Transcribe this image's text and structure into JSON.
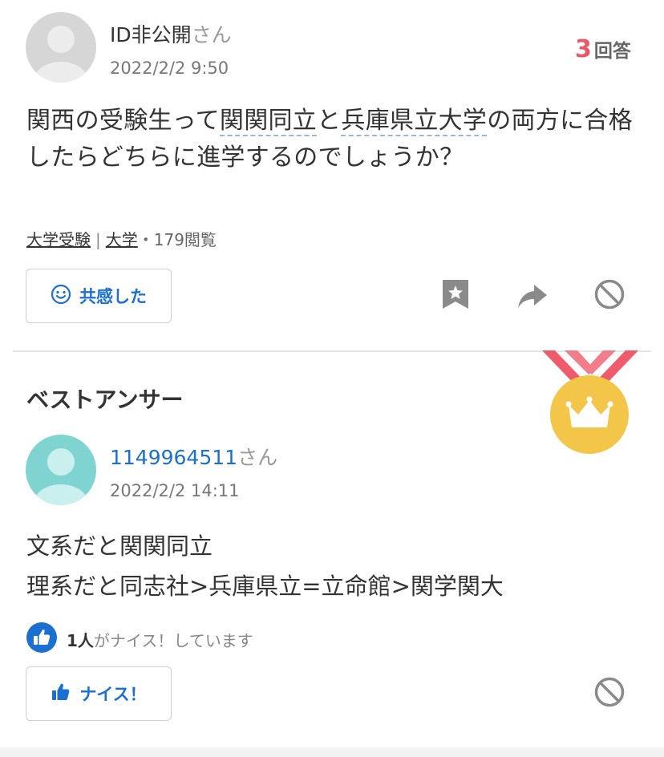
{
  "question": {
    "user_name": "ID非公開",
    "honorific": "さん",
    "timestamp": "2022/2/2 9:50",
    "answer_count": "3",
    "answer_label": "回答",
    "text_parts": [
      "関西の受験生って",
      "関関同立",
      "と",
      "兵庫県立大学",
      "の両方に合格したらどちらに進学するのでしょうか？"
    ],
    "categories": [
      "大学受験",
      "大学"
    ],
    "category_sep": "|",
    "views": "・179閲覧",
    "empathy_label": "共感した"
  },
  "best_answer": {
    "heading": "ベストアンサー",
    "user_name": "1149964511",
    "honorific": "さん",
    "timestamp": "2022/2/2 14:11",
    "lines": [
      "文系だと関関同立",
      "理系だと同志社>兵庫県立=立命館>関学関大"
    ],
    "nice_count": "1人",
    "nice_text": "がナイス！しています",
    "nice_button_label": "ナイス！"
  },
  "icons": {
    "bookmark": "bookmark-star-icon",
    "share": "share-arrow-icon",
    "block": "block-icon",
    "smile": "smile-icon",
    "thumbs_up": "thumbs-up-icon",
    "medal": "medal-crown-icon"
  },
  "colors": {
    "accent_blue": "#1a6fd1",
    "answer_count_red": "#ee5566",
    "medal_gold": "#f3c64a",
    "ribbon_red": "#ef5b6a"
  }
}
